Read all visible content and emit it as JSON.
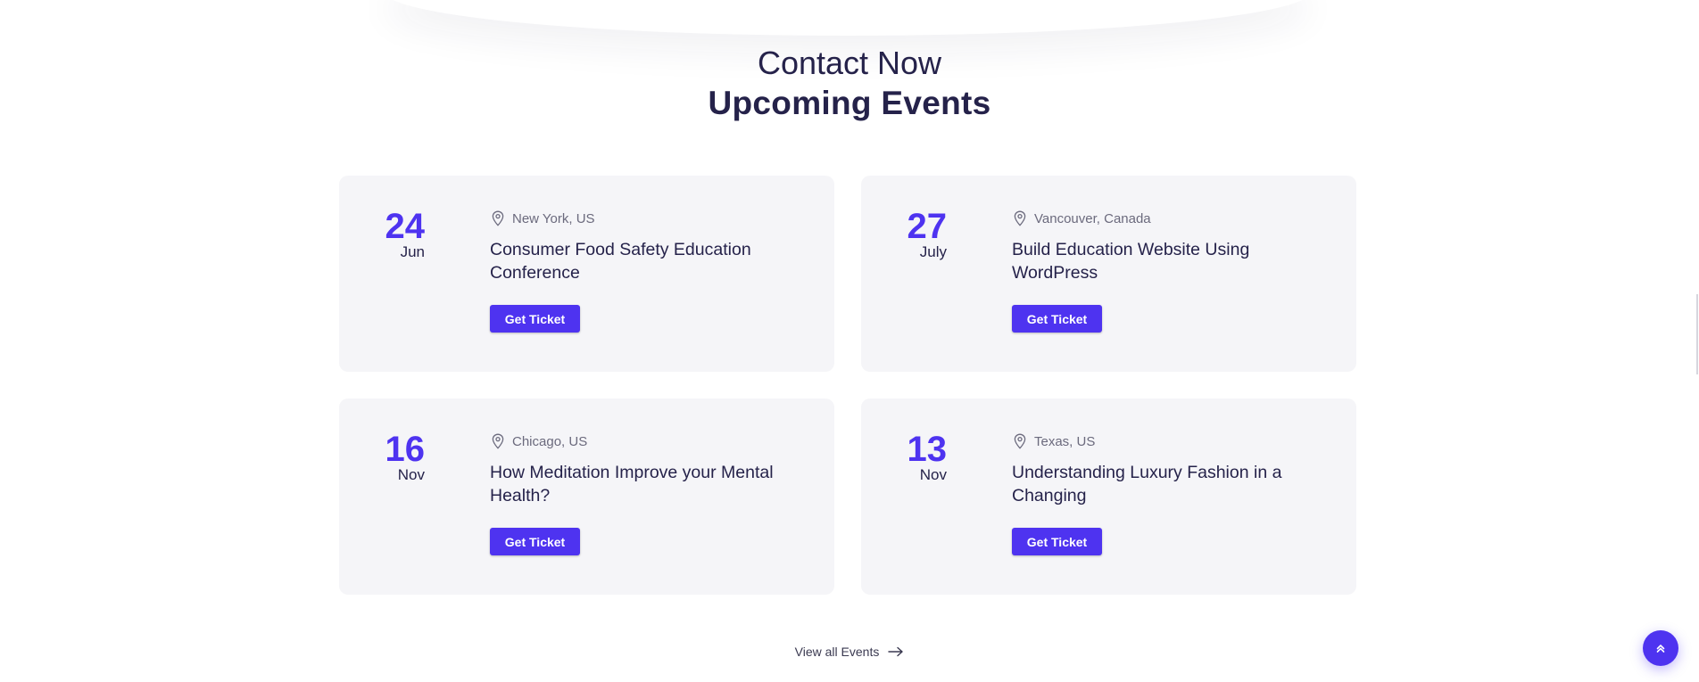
{
  "section": {
    "subtitle": "Contact Now",
    "title": "Upcoming Events"
  },
  "events": [
    {
      "day": "24",
      "month": "Jun",
      "location": "New York, US",
      "title": "Consumer Food Safety Education Conference",
      "button": "Get Ticket"
    },
    {
      "day": "27",
      "month": "July",
      "location": "Vancouver, Canada",
      "title": "Build Education Website Using WordPress",
      "button": "Get Ticket"
    },
    {
      "day": "16",
      "month": "Nov",
      "location": "Chicago, US",
      "title": "How Meditation Improve your Mental Health?",
      "button": "Get Ticket"
    },
    {
      "day": "13",
      "month": "Nov",
      "location": "Texas, US",
      "title": "Understanding Luxury Fashion in a Changing",
      "button": "Get Ticket"
    }
  ],
  "view_all": {
    "label": "View all Events",
    "icon": "arrow-right-icon"
  },
  "scroll_top": {
    "icon": "double-chevron-up-icon"
  },
  "colors": {
    "accent": "#4e33f0",
    "card_bg": "#f5f5f8",
    "heading": "#25224a",
    "muted": "#6b6a7d"
  }
}
